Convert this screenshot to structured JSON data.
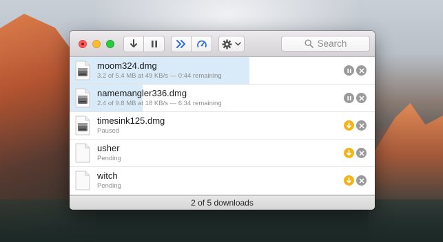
{
  "colors": {
    "accent": "#2f6fdb",
    "progress_fill": "#d9ebf9",
    "resume_button": "#f3b418",
    "control_gray": "#9a9a9a"
  },
  "toolbar": {
    "buttons": [
      "download-all",
      "pause-all",
      "resume-all",
      "speed-limit",
      "settings"
    ],
    "search": {
      "placeholder": "Search"
    }
  },
  "downloads": [
    {
      "name": "moom324.dmg",
      "status": "3.2 of 5.4 MB at 49 KB/s — 0:44 remaining",
      "progress": 0.59,
      "state": "downloading",
      "icon": "disk-image-icon"
    },
    {
      "name": "namemangler336.dmg",
      "status": "2.4 of 9.8 MB at 18 KB/s — 6:34 remaining",
      "progress": 0.24,
      "state": "downloading",
      "icon": "disk-image-icon"
    },
    {
      "name": "timesink125.dmg",
      "status": "Paused",
      "progress": 0,
      "state": "paused",
      "icon": "disk-image-icon"
    },
    {
      "name": "usher",
      "status": "Pending",
      "progress": 0,
      "state": "pending",
      "icon": "document-icon"
    },
    {
      "name": "witch",
      "status": "Pending",
      "progress": 0,
      "state": "pending",
      "icon": "document-icon"
    }
  ],
  "footer": {
    "summary": "2 of 5 downloads"
  }
}
